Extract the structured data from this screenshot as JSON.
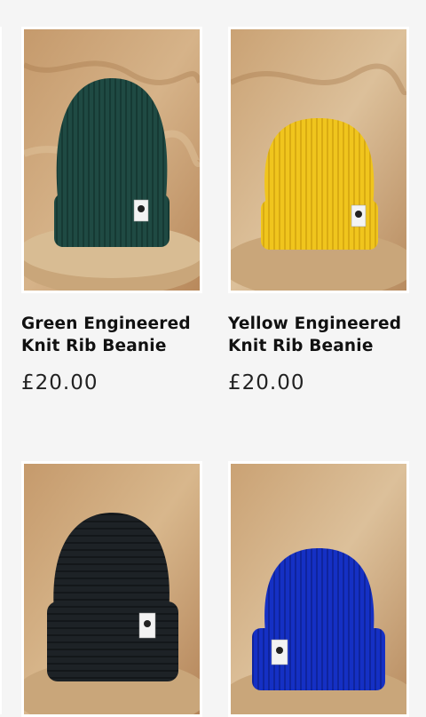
{
  "products": [
    {
      "title": "Green Engineered Knit Rib Beanie",
      "price": "£20.00",
      "color": "#1f4a43",
      "shade": "#163a34",
      "image_alt": "green-beanie"
    },
    {
      "title": "Yellow Engineered Knit Rib Beanie",
      "price": "£20.00",
      "color": "#f0c51d",
      "shade": "#d9ab12",
      "image_alt": "yellow-beanie"
    },
    {
      "title": "",
      "price": "",
      "color": "#1d2226",
      "shade": "#13171a",
      "image_alt": "black-beanie"
    },
    {
      "title": "",
      "price": "",
      "color": "#1530c4",
      "shade": "#0f249d",
      "image_alt": "blue-beanie"
    }
  ]
}
